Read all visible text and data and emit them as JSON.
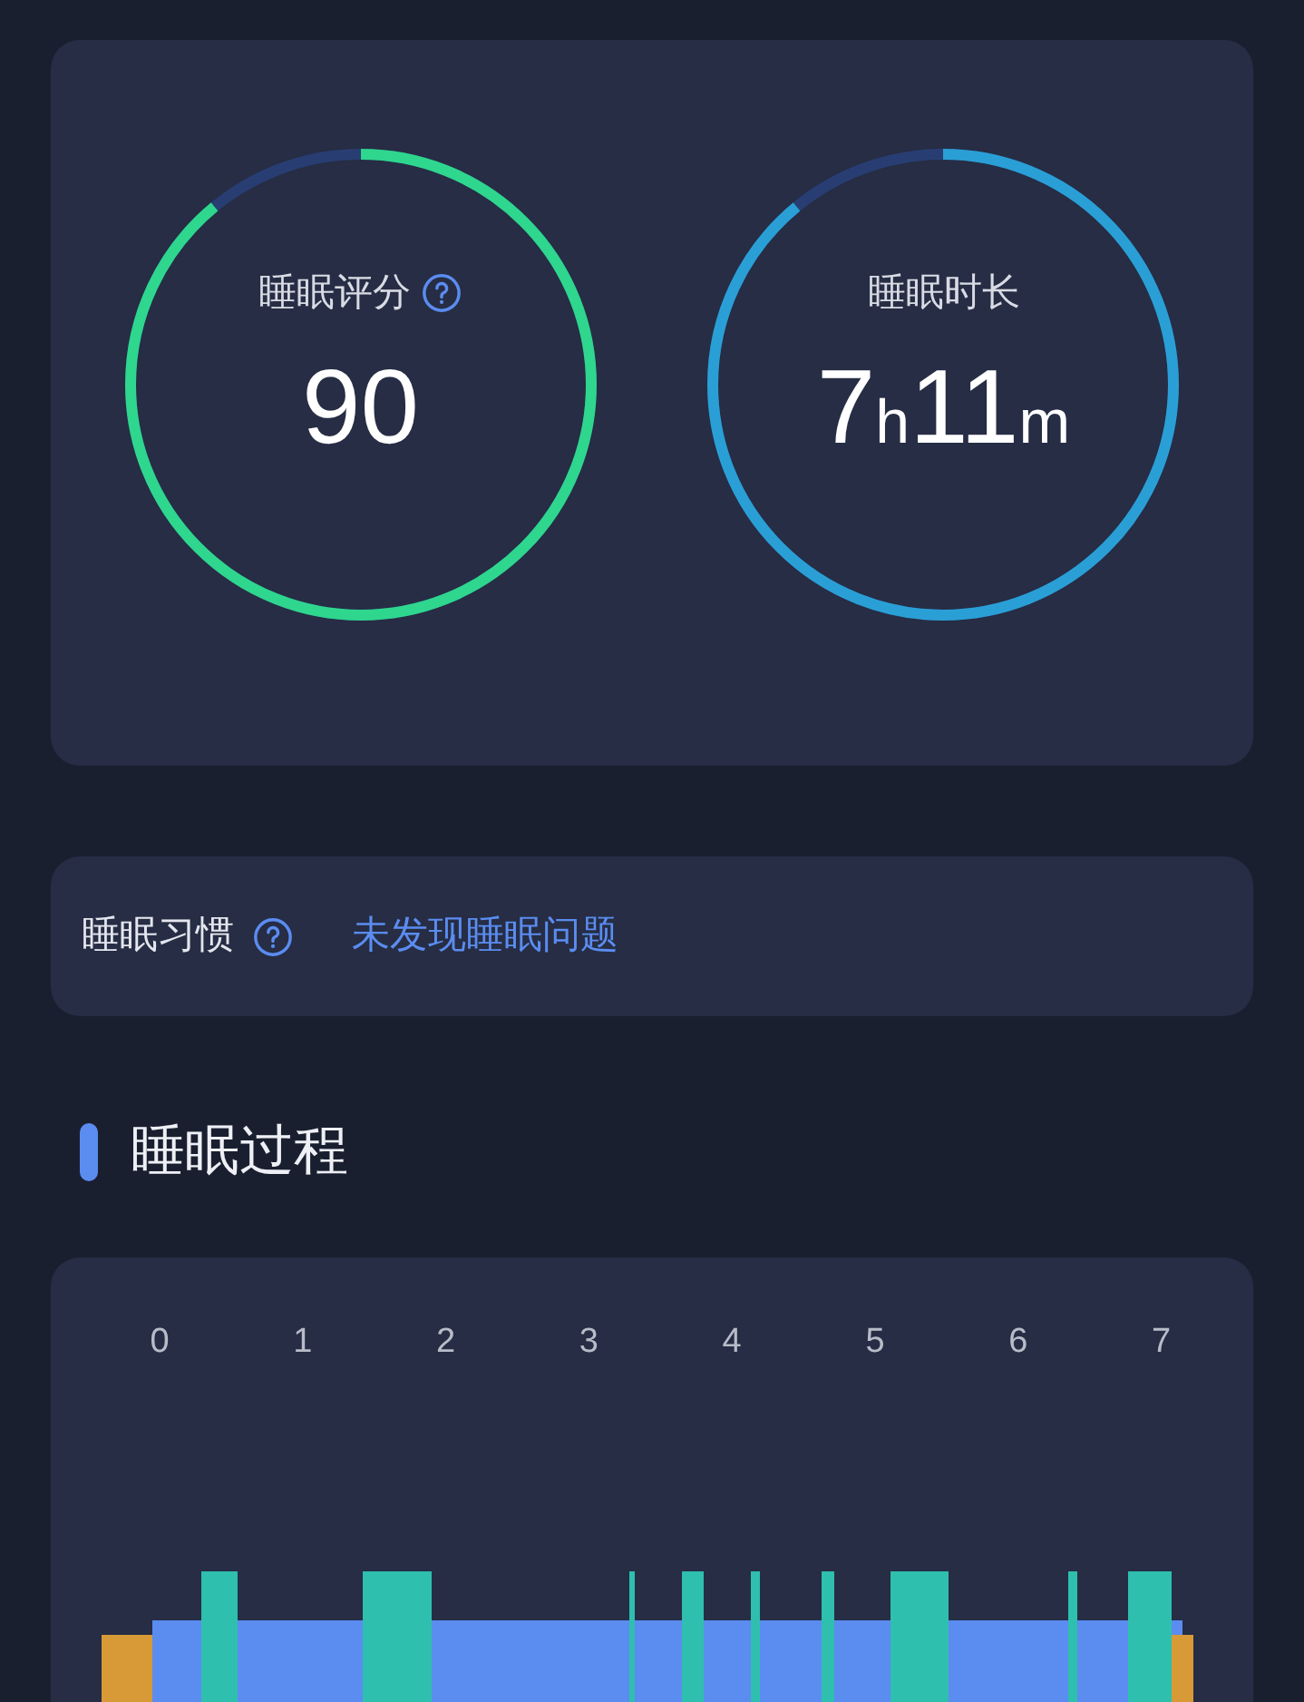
{
  "summary": {
    "rings": [
      {
        "label": "睡眠评分",
        "help": true,
        "value": [
          {
            "text": "90",
            "unit": false
          }
        ],
        "color": "#2fd68e",
        "level": 0.89
      },
      {
        "label": "睡眠时长",
        "help": false,
        "value": [
          {
            "text": "7",
            "unit": false
          },
          {
            "text": "h",
            "unit": true
          },
          {
            "text": "11",
            "unit": false
          },
          {
            "text": "m",
            "unit": true
          }
        ],
        "color": "#2a9fd6",
        "level": 0.89
      }
    ]
  },
  "habit": {
    "label": "睡眠习惯",
    "help": true,
    "value": "未发现睡眠问题"
  },
  "section": {
    "title": "睡眠过程"
  },
  "hypnogram": {
    "hour_ticks": [
      "0",
      "1",
      "2",
      "3",
      "4",
      "5",
      "6",
      "7"
    ]
  }
}
